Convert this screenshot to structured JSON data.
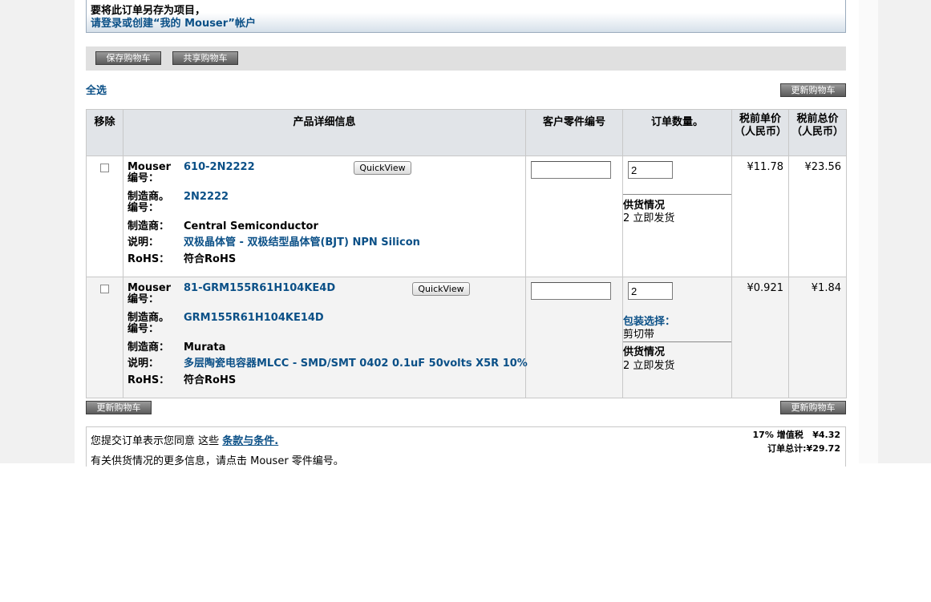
{
  "notice": {
    "line1": "要将此订单另存为项目，",
    "line2": "请登录或创建“我的 Mouser”帐户"
  },
  "toolbar": {
    "save_cart": "保存购物车",
    "share_cart": "共享购物车"
  },
  "select_all": "全选",
  "update_cart": "更新购物车",
  "table": {
    "headers": {
      "remove": "移除",
      "details": "产品详细信息",
      "customer_part": "客户零件编号",
      "order_qty": "订单数量。",
      "unit_price": "税前单价（人民币）",
      "total_price": "税前总价（人民币）"
    },
    "labels": {
      "mouser_no": "Mouser 编号：",
      "mfr_no": "制造商。编号：",
      "mfr": "制造商：",
      "desc": "说明：",
      "rohs": "RoHS："
    },
    "quickview": "QuickView",
    "availability_label": "供货情况",
    "package_label": "包装选择：",
    "rows": [
      {
        "mouser_no": "610-2N2222",
        "mfr_no": "2N2222",
        "mfr": "Central Semiconductor",
        "desc": "双极晶体管 - 双极结型晶体管(BJT) NPN Silicon",
        "rohs": "符合RoHS",
        "customer_part": "",
        "qty": "2",
        "availability": "2 立即发货",
        "unit_price": "¥11.78",
        "total_price": "¥23.56"
      },
      {
        "mouser_no": "81-GRM155R61H104KE4D",
        "mfr_no": "GRM155R61H104KE14D",
        "mfr": "Murata",
        "desc": "多层陶瓷电容器MLCC - SMD/SMT 0402 0.1uF 50volts X5R 10%",
        "rohs": "符合RoHS",
        "customer_part": "",
        "qty": "2",
        "package": "剪切带",
        "availability": "2 立即发货",
        "unit_price": "¥0.921",
        "total_price": "¥1.84"
      }
    ]
  },
  "terms": {
    "text_before": "您提交订单表示您同意 这些 ",
    "link": "条款与条件.",
    "availability_hint": "有关供货情况的更多信息，请点击 Mouser 零件编号。",
    "tax_label": "17% 增值税",
    "tax_value": "¥4.32",
    "total_label": "订单总计:",
    "total_value": "¥29.72"
  }
}
